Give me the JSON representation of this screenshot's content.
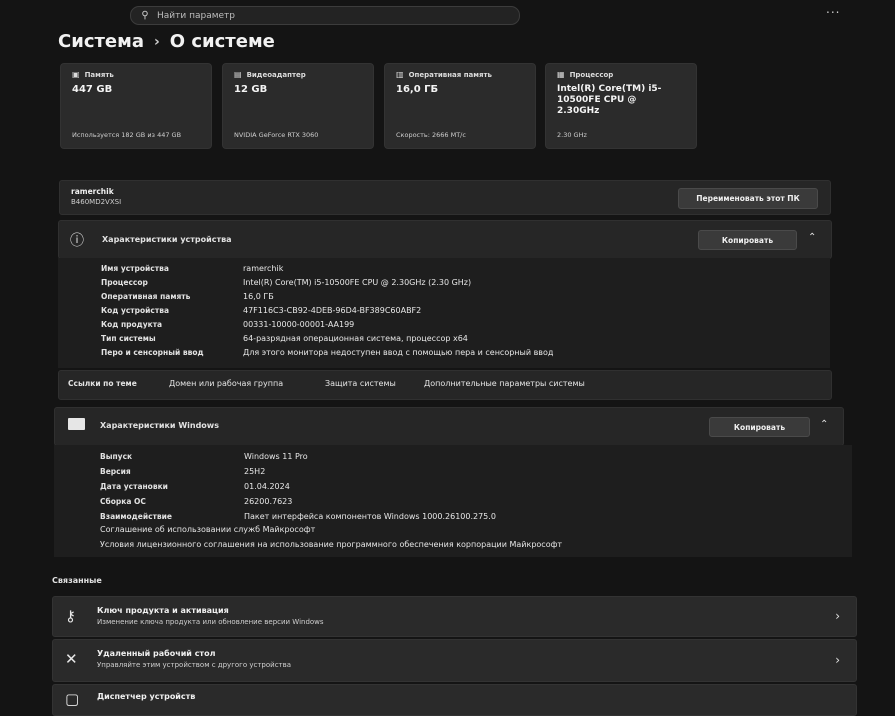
{
  "search": {
    "placeholder": "Найти параметр"
  },
  "header": {
    "more": "...",
    "breadcrumb_parent": "Система",
    "breadcrumb_sep": "›",
    "breadcrumb_current": "О системе"
  },
  "tiles": [
    {
      "title": "Память",
      "value": "447 GB",
      "sub": "Используется 182 GB из 447 GB",
      "icon": "storage-icon"
    },
    {
      "title": "Видеоадаптер",
      "value": "12 GB",
      "sub": "NVIDIA GeForce RTX 3060",
      "icon": "gpu-icon"
    },
    {
      "title": "Оперативная память",
      "value": "16,0 ГБ",
      "sub": "Скорость: 2666 МТ/с",
      "icon": "ram-icon"
    },
    {
      "title": "Процессор",
      "value": "Intel(R) Core(TM) i5-10500FE CPU @ 2.30GHz",
      "sub": "2.30 GHz",
      "icon": "cpu-icon"
    }
  ],
  "device": {
    "name": "ramerchik",
    "model": "B460MD2VXSI",
    "rename_label": "Переименовать этот ПК"
  },
  "device_specs": {
    "title": "Характеристики устройства",
    "copy_label": "Копировать",
    "rows": [
      {
        "label": "Имя устройства",
        "value": "ramerchik"
      },
      {
        "label": "Процессор",
        "value": "Intel(R) Core(TM) i5-10500FE CPU @ 2.30GHz (2.30 GHz)"
      },
      {
        "label": "Оперативная память",
        "value": "16,0 ГБ"
      },
      {
        "label": "Код устройства",
        "value": "47F116C3-CB92-4DEB-96D4-BF389C60ABF2"
      },
      {
        "label": "Код продукта",
        "value": "00331-10000-00001-AA199"
      },
      {
        "label": "Тип системы",
        "value": "64-разрядная операционная система, процессор x64"
      },
      {
        "label": "Перо и сенсорный ввод",
        "value": "Для этого монитора недоступен ввод с помощью пера и сенсорный ввод"
      }
    ]
  },
  "related_links": {
    "title": "Ссылки по теме",
    "items": [
      "Домен или рабочая группа",
      "Защита системы",
      "Дополнительные параметры системы"
    ]
  },
  "windows_specs": {
    "title": "Характеристики Windows",
    "copy_label": "Копировать",
    "rows": [
      {
        "label": "Выпуск",
        "value": "Windows 11 Pro"
      },
      {
        "label": "Версия",
        "value": "25H2"
      },
      {
        "label": "Дата установки",
        "value": "01.04.2024"
      },
      {
        "label": "Сборка ОС",
        "value": "26200.7623"
      },
      {
        "label": "Взаимодействие",
        "value": "Пакет интерфейса компонентов Windows 1000.26100.275.0"
      }
    ],
    "links": [
      "Соглашение об использовании служб Майкрософт",
      "Условия лицензионного соглашения на использование программного обеспечения корпорации Майкрософт"
    ]
  },
  "related": {
    "title": "Связанные",
    "items": [
      {
        "title": "Ключ продукта и активация",
        "subtitle": "Изменение ключа продукта или обновление версии Windows",
        "icon": "key-icon"
      },
      {
        "title": "Удаленный рабочий стол",
        "subtitle": "Управляйте этим устройством с другого устройства",
        "icon": "remote-desktop-icon"
      },
      {
        "title": "Диспетчер устройств",
        "subtitle": "",
        "icon": "device-manager-icon"
      }
    ]
  }
}
